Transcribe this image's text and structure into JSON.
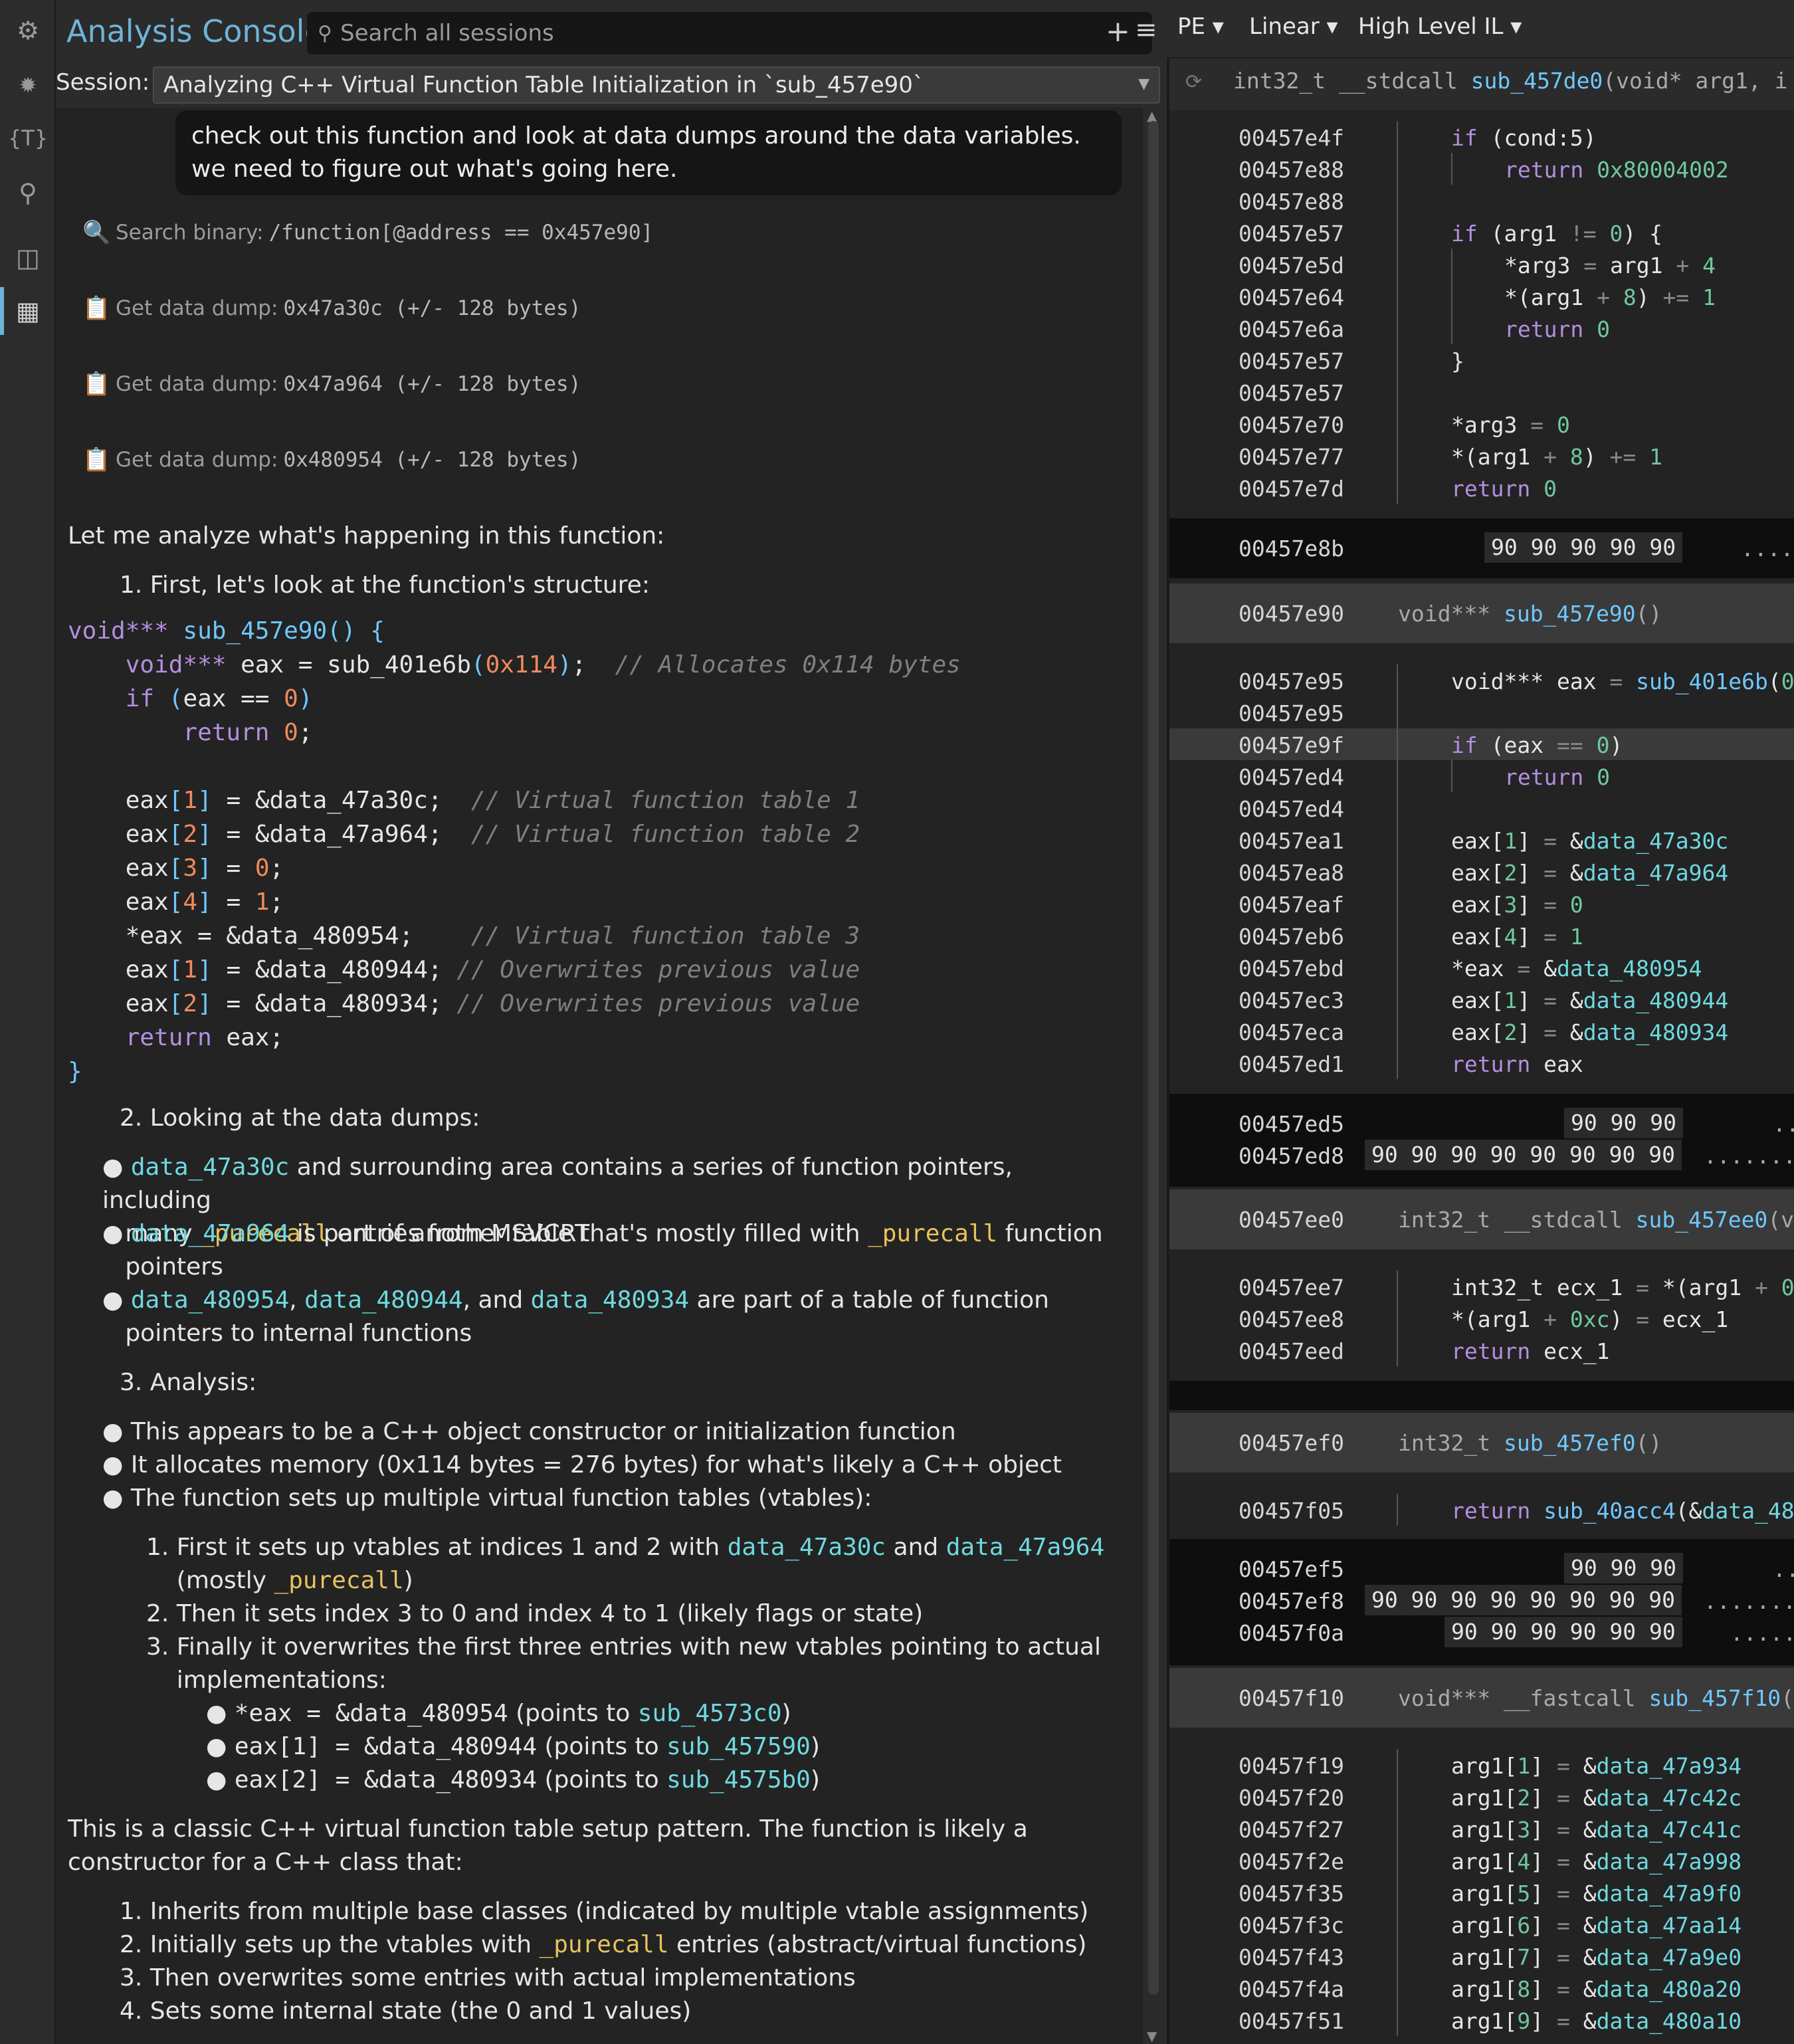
{
  "app": {
    "title": "Analysis Console"
  },
  "search": {
    "placeholder": "Search all sessions"
  },
  "session": {
    "label": "Session:",
    "value": "Analyzing C++ Virtual Function Table Initialization in `sub_457e90`"
  },
  "chat": {
    "user_message": "check out this function and look at data dumps around the data variables. we need to figure out what's going here.",
    "tools": [
      {
        "label": "Search binary:",
        "arg": "/function[@address == 0x457e90]",
        "icon": "magnifier-icon"
      },
      {
        "label": "Get data dump:",
        "arg": "0x47a30c (+/- 128 bytes)",
        "icon": "clipboard-icon"
      },
      {
        "label": "Get data dump:",
        "arg": "0x47a964 (+/- 128 bytes)",
        "icon": "clipboard-icon"
      },
      {
        "label": "Get data dump:",
        "arg": "0x480954 (+/- 128 bytes)",
        "icon": "clipboard-icon"
      }
    ],
    "intro": "Let me analyze what's happening in this function:",
    "step1": "1. First, let's look at the function's structure:",
    "step2": "2. Looking at the data dumps:",
    "step3": "3. Analysis:",
    "closing": "This is a classic C++ virtual function table setup pattern. The function is likely a constructor for a C++ class that:",
    "final_list": [
      "1. Inherits from multiple base classes (indicated by multiple vtable assignments)",
      "3. Then overwrites some entries with actual implementations",
      "4. Sets some internal state (the 0 and 1 values)"
    ]
  },
  "right": {
    "menus": [
      "PE",
      "Linear",
      "High Level IL"
    ],
    "header_sig": "int32_t __stdcall sub_457de0(void* arg1, i"
  },
  "colors": {
    "accent": "#6fb3d8",
    "data_ref": "#6fd9e0",
    "purecall": "#e6c35c",
    "keyword": "#b58ee0"
  }
}
